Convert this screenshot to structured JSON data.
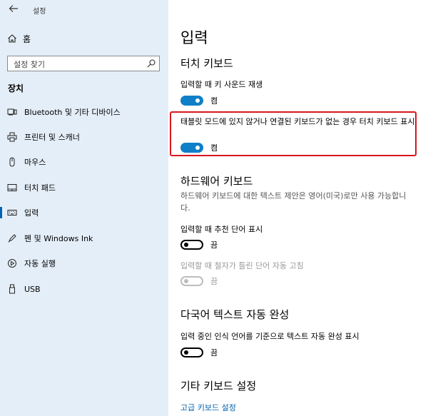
{
  "app": {
    "title": "설정"
  },
  "sidebar": {
    "home_label": "홈",
    "search_placeholder": "설정 찾기",
    "section_label": "장치",
    "items": [
      {
        "label": "Bluetooth 및 기타 디바이스",
        "icon": "bluetooth-devices-icon",
        "active": false
      },
      {
        "label": "프린터 및 스캐너",
        "icon": "printer-icon",
        "active": false
      },
      {
        "label": "마우스",
        "icon": "mouse-icon",
        "active": false
      },
      {
        "label": "터치 패드",
        "icon": "touchpad-icon",
        "active": false
      },
      {
        "label": "입력",
        "icon": "keyboard-icon",
        "active": true
      },
      {
        "label": "펜 및 Windows Ink",
        "icon": "pen-icon",
        "active": false
      },
      {
        "label": "자동 실행",
        "icon": "autoplay-icon",
        "active": false
      },
      {
        "label": "USB",
        "icon": "usb-icon",
        "active": false
      }
    ]
  },
  "main": {
    "title": "입력",
    "touch_keyboard": {
      "heading": "터치 키보드",
      "sound_label": "입력할 때 키 사운드 재생",
      "sound_state": "켬",
      "show_label": "태블릿 모드에 있지 않거나 연결된 키보드가 없는 경우 터치 키보드 표시",
      "show_state": "켬"
    },
    "hardware_keyboard": {
      "heading": "하드웨어 키보드",
      "description": "하드웨어 키보드에 대한 텍스트 제안은 영어(미국)로만 사용 가능합니다.",
      "suggest_label": "입력할 때 추천 단어 표시",
      "suggest_state": "끔",
      "autocorrect_label": "입력할 때 철자가 틀린 단어 자동 고침",
      "autocorrect_state": "끔"
    },
    "multilingual": {
      "heading": "다국어 텍스트 자동 완성",
      "label": "입력 중인 인식 언어를 기준으로 텍스트 자동 완성 표시",
      "state": "끔"
    },
    "other": {
      "heading": "기타 키보드 설정",
      "advanced_link": "고급 키보드 설정"
    }
  },
  "colors": {
    "accent": "#0f7fc7",
    "sidebar_bg": "#e4eef8",
    "highlight": "#d9161c",
    "link": "#0063b1"
  }
}
